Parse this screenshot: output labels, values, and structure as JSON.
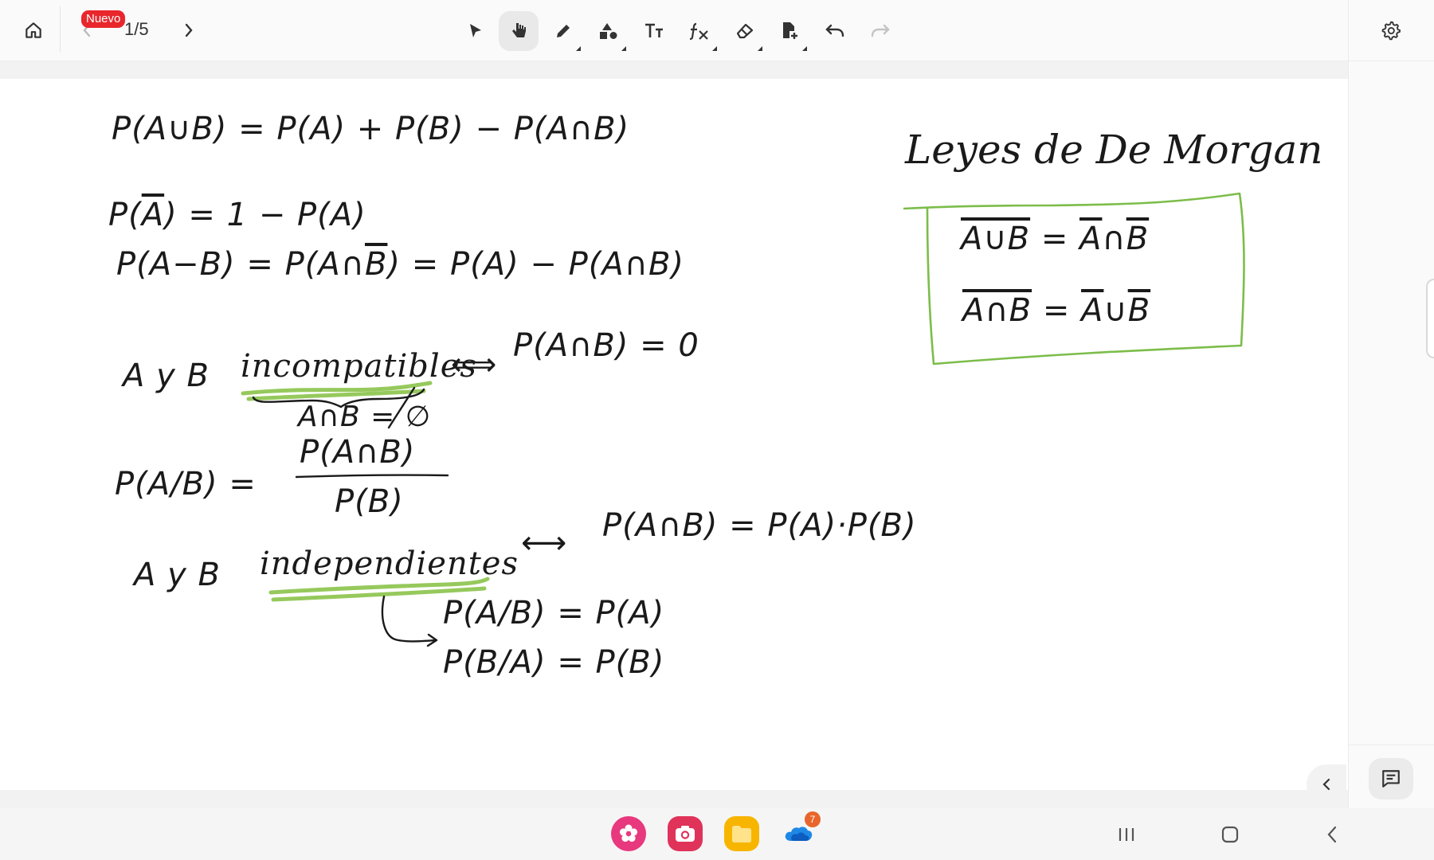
{
  "toolbar": {
    "page_indicator": "1/5",
    "new_badge": "Nuevo",
    "tools": [
      "select",
      "hand",
      "pen",
      "shapes",
      "text",
      "formula",
      "eraser",
      "add-page",
      "undo",
      "redo"
    ],
    "active_tool": "hand"
  },
  "canvas": {
    "formulas": {
      "union": "P(A∪B) = P(A) + P(B) − P(A∩B)",
      "complement_lhs": "P(",
      "complement_a": "A",
      "complement_rhs": ") = 1 − P(A)",
      "difference_1": "P(A−B) = P(A∩",
      "difference_b": "B",
      "difference_2": ") = P(A) − P(A∩B)",
      "incompat_prefix": "A y B",
      "incompat_word": "incompatibles",
      "incompat_arrow": "⟺",
      "incompat_result": "P(A∩B) = 0",
      "incompat_note": "A∩B = ∅",
      "conditional_lhs": "P(A/B) =",
      "conditional_num": "P(A∩B)",
      "conditional_den": "P(B)",
      "indep_prefix": "A y B",
      "indep_word": "independientes",
      "indep_arrow": "⟷",
      "indep_result": "P(A∩B) = P(A)·P(B)",
      "indep_cond_1": "P(A/B) = P(A)",
      "indep_cond_2": "P(B/A) = P(B)"
    },
    "morgan": {
      "title": "Leyes de De Morgan",
      "law1_lhs": "A∪B",
      "law1_eq": "=",
      "law1_a": "A",
      "law1_op": "∩",
      "law1_b": "B",
      "law2_lhs": "A∩B",
      "law2_eq": "=",
      "law2_a": "A",
      "law2_op": "∪",
      "law2_b": "B"
    }
  },
  "dock": {
    "apps": [
      "blossom-app",
      "camera-app",
      "files-app",
      "onedrive-app"
    ],
    "onedrive_badge": "7"
  },
  "colors": {
    "highlight": "#8bc34a",
    "box": "#7cbd4a",
    "badge_red": "#e8262c",
    "ink": "#1a1a1a"
  }
}
